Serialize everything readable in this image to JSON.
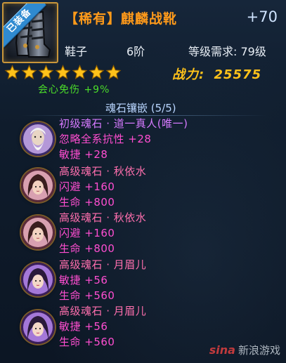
{
  "item": {
    "equipped_badge": "已装备",
    "title": "【稀有】麒麟战靴",
    "plus_level": "+70",
    "type": "鞋子",
    "tier": "6阶",
    "level_req": "等级需求: 79级",
    "stars": 7,
    "power_label": "战力:",
    "power_value": "25575",
    "crit_resist": "会心免伤 +9%"
  },
  "sockets": {
    "title": "魂石镶嵌 (5/5)",
    "gems": [
      {
        "name": "初级魂石 · 道一真人(唯一)",
        "stats": [
          "忽略全系抗性 +28",
          "敏捷 +28"
        ],
        "portrait": "old-sage-portrait"
      },
      {
        "name": "高级魂石 · 秋依水",
        "stats": [
          "闪避 +160",
          "生命 +800"
        ],
        "portrait": "woman-portrait"
      },
      {
        "name": "高级魂石 · 秋依水",
        "stats": [
          "闪避 +160",
          "生命 +800"
        ],
        "portrait": "woman-portrait"
      },
      {
        "name": "高级魂石 · 月眉儿",
        "stats": [
          "敏捷 +56",
          "生命 +560"
        ],
        "portrait": "girl-portrait"
      },
      {
        "name": "高级魂石 · 月眉儿",
        "stats": [
          "敏捷 +56",
          "生命 +560"
        ],
        "portrait": "girl-portrait"
      }
    ]
  },
  "watermark": {
    "brand": "sina",
    "text": "新浪游戏"
  },
  "colors": {
    "title": "#ff9a1a",
    "power": "#ffc21a",
    "stat": "#ff4ed1",
    "gem_primary": "#d67aff",
    "gem_secondary": "#ff6fae",
    "frame": "#c9963a"
  }
}
